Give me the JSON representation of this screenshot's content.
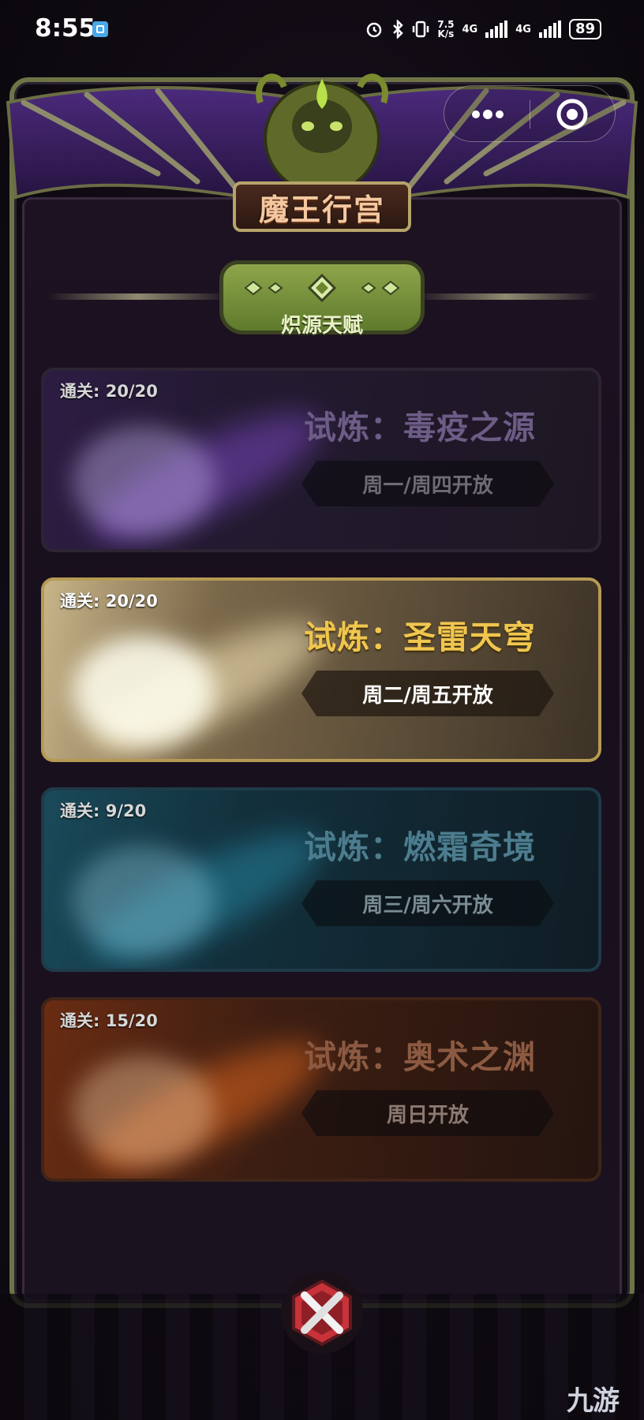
{
  "status_bar": {
    "time": "8:55",
    "net_speed_value": "7.5",
    "net_speed_unit": "K/s",
    "network_1": "4G",
    "network_2": "4G",
    "battery": "89"
  },
  "header": {
    "title": "魔王行宫",
    "subtitle": "炽源天赋"
  },
  "trials": [
    {
      "progress": "通关: 20/20",
      "name": "试炼：毒疫之源",
      "schedule": "周一/周四开放",
      "state": "locked"
    },
    {
      "progress": "通关: 20/20",
      "name": "试炼：圣雷天穹",
      "schedule": "周二/周五开放",
      "state": "open"
    },
    {
      "progress": "通关: 9/20",
      "name": "试炼：燃霜奇境",
      "schedule": "周三/周六开放",
      "state": "locked"
    },
    {
      "progress": "通关: 15/20",
      "name": "试炼：奥术之渊",
      "schedule": "周日开放",
      "state": "locked"
    }
  ],
  "icons": {
    "close": "close-icon",
    "more": "more-dots-icon",
    "target": "target-icon"
  },
  "watermark": "九游",
  "colors": {
    "frame": "#6e7446",
    "title_text": "#f4c8a0",
    "active_trial": "#f0c64f",
    "close_red": "#c8323a"
  }
}
